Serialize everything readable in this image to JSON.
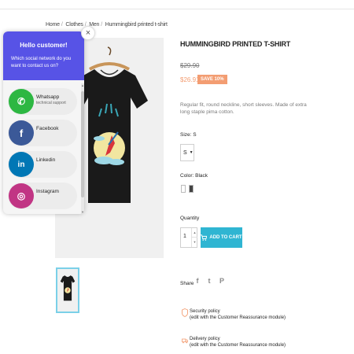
{
  "breadcrumb": {
    "items": [
      "Home",
      "Clothes",
      "Men",
      "Hummingbird printed t-shirt"
    ],
    "separator": "/"
  },
  "product": {
    "title": "HUMMINGBIRD PRINTED T-SHIRT",
    "old_price": "$29.90",
    "price": "$26.91",
    "discount_badge": "SAVE 10%",
    "description": "Regular fit, round neckline, short sleeves. Made of extra long staple pima cotton.",
    "size_label": "Size: S",
    "size_value": "S",
    "color_label": "Color: Black",
    "colors": [
      "#ffffff",
      "#434343"
    ],
    "quantity_label": "Quantity",
    "quantity_value": "1",
    "add_to_cart_label": "ADD TO CART",
    "accent_color": "#2fb5d2",
    "price_color": "#f39d72"
  },
  "share": {
    "label": "Share",
    "icons": [
      "facebook-icon",
      "twitter-icon",
      "pinterest-icon"
    ],
    "glyphs": [
      "f",
      "t",
      "P"
    ]
  },
  "reassurance": [
    {
      "icon": "shield-icon",
      "title": "Security policy",
      "text": "(edit with the Customer Reassurance module)"
    },
    {
      "icon": "truck-icon",
      "title": "Delivery policy",
      "text": "(edit with the Customer Reassurance module)"
    }
  ],
  "chat_popup": {
    "title": "Hello customer!",
    "subtitle": "Which social network do you want to contact us on?",
    "close_glyph": "×",
    "header_color": "#5753e6",
    "items": [
      {
        "name": "Whatsapp",
        "sub": "technical support",
        "icon": "whatsapp-icon",
        "color": "#2db742",
        "glyph": "✆"
      },
      {
        "name": "Facebook",
        "sub": "",
        "icon": "messenger-icon",
        "color": "#3b5998",
        "glyph": "f"
      },
      {
        "name": "Linkedin",
        "sub": "",
        "icon": "linkedin-icon",
        "color": "#0077b5",
        "glyph": "in"
      },
      {
        "name": "Instagram",
        "sub": "",
        "icon": "instagram-icon",
        "color": "#c13584",
        "glyph": "◎"
      }
    ]
  }
}
